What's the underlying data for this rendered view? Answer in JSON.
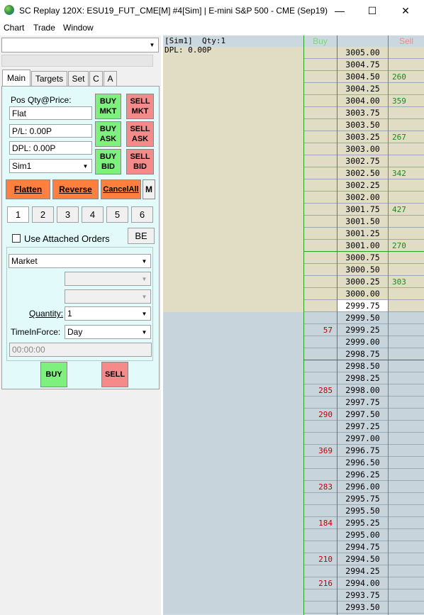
{
  "window": {
    "title": "SC Replay 120X: ESU19_FUT_CME[M]  #4[Sim]  | E-mini S&P 500 - CME (Sep19)",
    "minimize": "—",
    "maximize": "☐",
    "close": "✕"
  },
  "menu": [
    "Chart",
    "Trade",
    "Window"
  ],
  "tabs": [
    "Main",
    "Targets",
    "Set",
    "C",
    "A"
  ],
  "panel": {
    "pos_qty_label": "Pos Qty@Price:",
    "position_value": "Flat",
    "pl_value": "P/L: 0.00P",
    "dpl_value": "DPL: 0.00P",
    "account": "Sim1",
    "buy_mkt": [
      "BUY",
      "MKT"
    ],
    "sell_mkt": [
      "SELL",
      "MKT"
    ],
    "buy_ask": [
      "BUY",
      "ASK"
    ],
    "sell_ask": [
      "SELL",
      "ASK"
    ],
    "buy_bid": [
      "BUY",
      "BID"
    ],
    "sell_bid": [
      "SELL",
      "BID"
    ],
    "flatten": "Flatten",
    "reverse": "Reverse",
    "cancel_all": "CancelAll",
    "m": "M",
    "quantity_buttons": [
      "1",
      "2",
      "3",
      "4",
      "5",
      "6"
    ],
    "use_attached_orders": "Use Attached Orders",
    "be": "BE",
    "order_type": "Market",
    "quantity_label": "Quantity:",
    "quantity_value": "1",
    "tif_label": "TimeInForce:",
    "tif_value": "Day",
    "time_value": "00:00:00",
    "buy": "BUY",
    "sell": "SELL"
  },
  "dom": {
    "info_line1": "[Sim1]  Qty:1",
    "info_line2": "DPL: 0.00P",
    "buy_header": "Buy",
    "sell_header": "Sell",
    "current_price": "2999.75",
    "colors": {
      "ask_bg": "#e0ddc4",
      "bid_bg": "#c8d4dc",
      "buy_text": "#c00000",
      "sell_text": "#1a8a1a",
      "buy_header": "#7fd67f",
      "sell_header": "#f08a8a"
    },
    "rows": [
      {
        "price": "3005.00",
        "buy": "",
        "sell": "",
        "side": "ask"
      },
      {
        "price": "3004.75",
        "buy": "",
        "sell": "",
        "side": "ask"
      },
      {
        "price": "3004.50",
        "buy": "",
        "sell": "260",
        "side": "ask"
      },
      {
        "price": "3004.25",
        "buy": "",
        "sell": "",
        "side": "ask"
      },
      {
        "price": "3004.00",
        "buy": "",
        "sell": "359",
        "side": "ask"
      },
      {
        "price": "3003.75",
        "buy": "",
        "sell": "",
        "side": "ask"
      },
      {
        "price": "3003.50",
        "buy": "",
        "sell": "",
        "side": "ask"
      },
      {
        "price": "3003.25",
        "buy": "",
        "sell": "267",
        "side": "ask"
      },
      {
        "price": "3003.00",
        "buy": "",
        "sell": "",
        "side": "ask"
      },
      {
        "price": "3002.75",
        "buy": "",
        "sell": "",
        "side": "ask"
      },
      {
        "price": "3002.50",
        "buy": "",
        "sell": "342",
        "side": "ask"
      },
      {
        "price": "3002.25",
        "buy": "",
        "sell": "",
        "side": "ask"
      },
      {
        "price": "3002.00",
        "buy": "",
        "sell": "",
        "side": "ask"
      },
      {
        "price": "3001.75",
        "buy": "",
        "sell": "427",
        "side": "ask"
      },
      {
        "price": "3001.50",
        "buy": "",
        "sell": "",
        "side": "ask"
      },
      {
        "price": "3001.25",
        "buy": "",
        "sell": "",
        "side": "ask"
      },
      {
        "price": "3001.00",
        "buy": "",
        "sell": "270",
        "side": "ask"
      },
      {
        "price": "3000.75",
        "buy": "",
        "sell": "",
        "side": "ask"
      },
      {
        "price": "3000.50",
        "buy": "",
        "sell": "",
        "side": "ask"
      },
      {
        "price": "3000.25",
        "buy": "",
        "sell": "303",
        "side": "ask"
      },
      {
        "price": "3000.00",
        "buy": "",
        "sell": "",
        "side": "ask"
      },
      {
        "price": "2999.75",
        "buy": "",
        "sell": "",
        "side": "ask"
      },
      {
        "price": "2999.50",
        "buy": "",
        "sell": "",
        "side": "bid"
      },
      {
        "price": "2999.25",
        "buy": "57",
        "sell": "",
        "side": "bid"
      },
      {
        "price": "2999.00",
        "buy": "",
        "sell": "",
        "side": "bid"
      },
      {
        "price": "2998.75",
        "buy": "",
        "sell": "",
        "side": "bid"
      },
      {
        "price": "2998.50",
        "buy": "",
        "sell": "",
        "side": "bid"
      },
      {
        "price": "2998.25",
        "buy": "",
        "sell": "",
        "side": "bid"
      },
      {
        "price": "2998.00",
        "buy": "285",
        "sell": "",
        "side": "bid"
      },
      {
        "price": "2997.75",
        "buy": "",
        "sell": "",
        "side": "bid"
      },
      {
        "price": "2997.50",
        "buy": "290",
        "sell": "",
        "side": "bid"
      },
      {
        "price": "2997.25",
        "buy": "",
        "sell": "",
        "side": "bid"
      },
      {
        "price": "2997.00",
        "buy": "",
        "sell": "",
        "side": "bid"
      },
      {
        "price": "2996.75",
        "buy": "369",
        "sell": "",
        "side": "bid"
      },
      {
        "price": "2996.50",
        "buy": "",
        "sell": "",
        "side": "bid"
      },
      {
        "price": "2996.25",
        "buy": "",
        "sell": "",
        "side": "bid"
      },
      {
        "price": "2996.00",
        "buy": "283",
        "sell": "",
        "side": "bid"
      },
      {
        "price": "2995.75",
        "buy": "",
        "sell": "",
        "side": "bid"
      },
      {
        "price": "2995.50",
        "buy": "",
        "sell": "",
        "side": "bid"
      },
      {
        "price": "2995.25",
        "buy": "184",
        "sell": "",
        "side": "bid"
      },
      {
        "price": "2995.00",
        "buy": "",
        "sell": "",
        "side": "bid"
      },
      {
        "price": "2994.75",
        "buy": "",
        "sell": "",
        "side": "bid"
      },
      {
        "price": "2994.50",
        "buy": "210",
        "sell": "",
        "side": "bid"
      },
      {
        "price": "2994.25",
        "buy": "",
        "sell": "",
        "side": "bid"
      },
      {
        "price": "2994.00",
        "buy": "216",
        "sell": "",
        "side": "bid"
      },
      {
        "price": "2993.75",
        "buy": "",
        "sell": "",
        "side": "bid"
      },
      {
        "price": "2993.50",
        "buy": "",
        "sell": "",
        "side": "bid"
      }
    ]
  }
}
